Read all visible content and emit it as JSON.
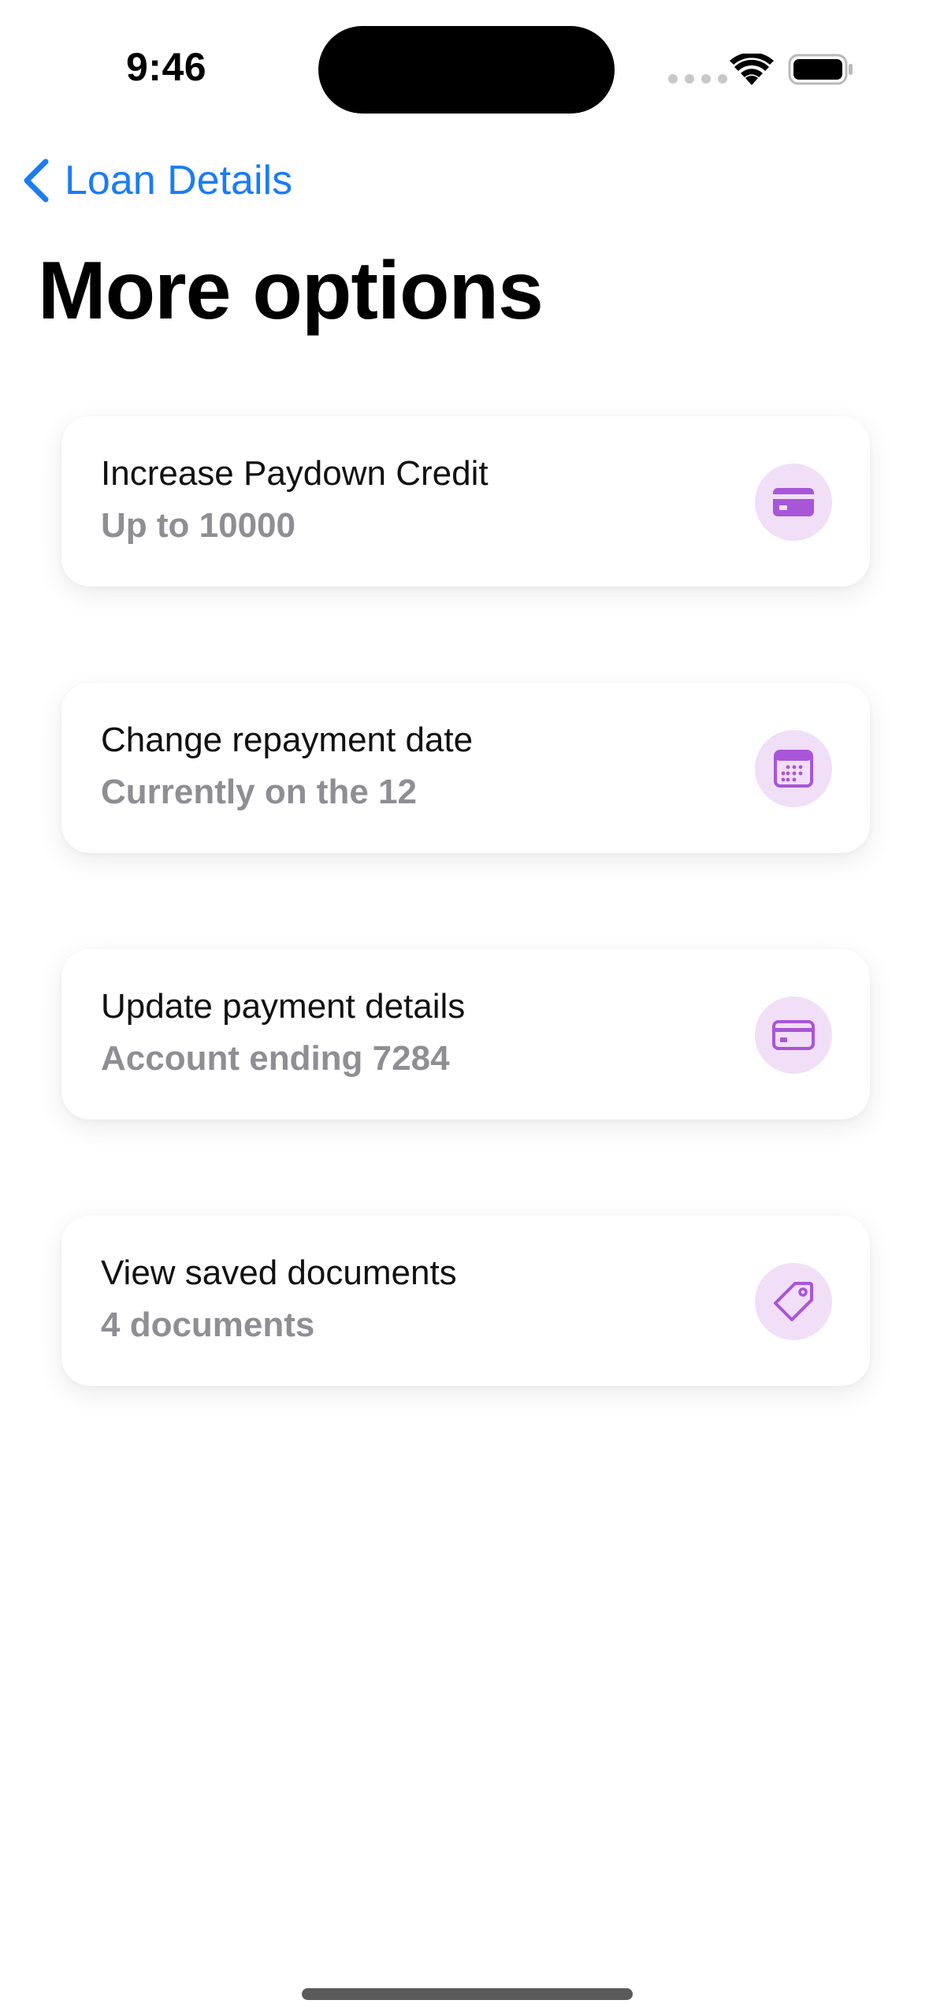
{
  "status_bar": {
    "time": "9:46",
    "icons": [
      "cellular-signal-icon",
      "wifi-icon",
      "battery-icon"
    ]
  },
  "nav": {
    "back_label": "Loan Details",
    "back_icon": "chevron-left-icon"
  },
  "page": {
    "title": "More options"
  },
  "options": [
    {
      "title": "Increase Paydown Credit",
      "subtitle": "Up to 10000",
      "icon": "credit-card-filled-icon"
    },
    {
      "title": "Change repayment date",
      "subtitle": "Currently on the 12",
      "icon": "calendar-icon"
    },
    {
      "title": "Update payment details",
      "subtitle": "Account ending 7284",
      "icon": "credit-card-outline-icon"
    },
    {
      "title": "View saved documents",
      "subtitle": "4 documents",
      "icon": "tag-icon"
    }
  ],
  "colors": {
    "accent": "#1a7cf5",
    "icon_fg": "#a855d8",
    "icon_bg": "#f0dff7",
    "subtitle": "#8e8e93"
  }
}
